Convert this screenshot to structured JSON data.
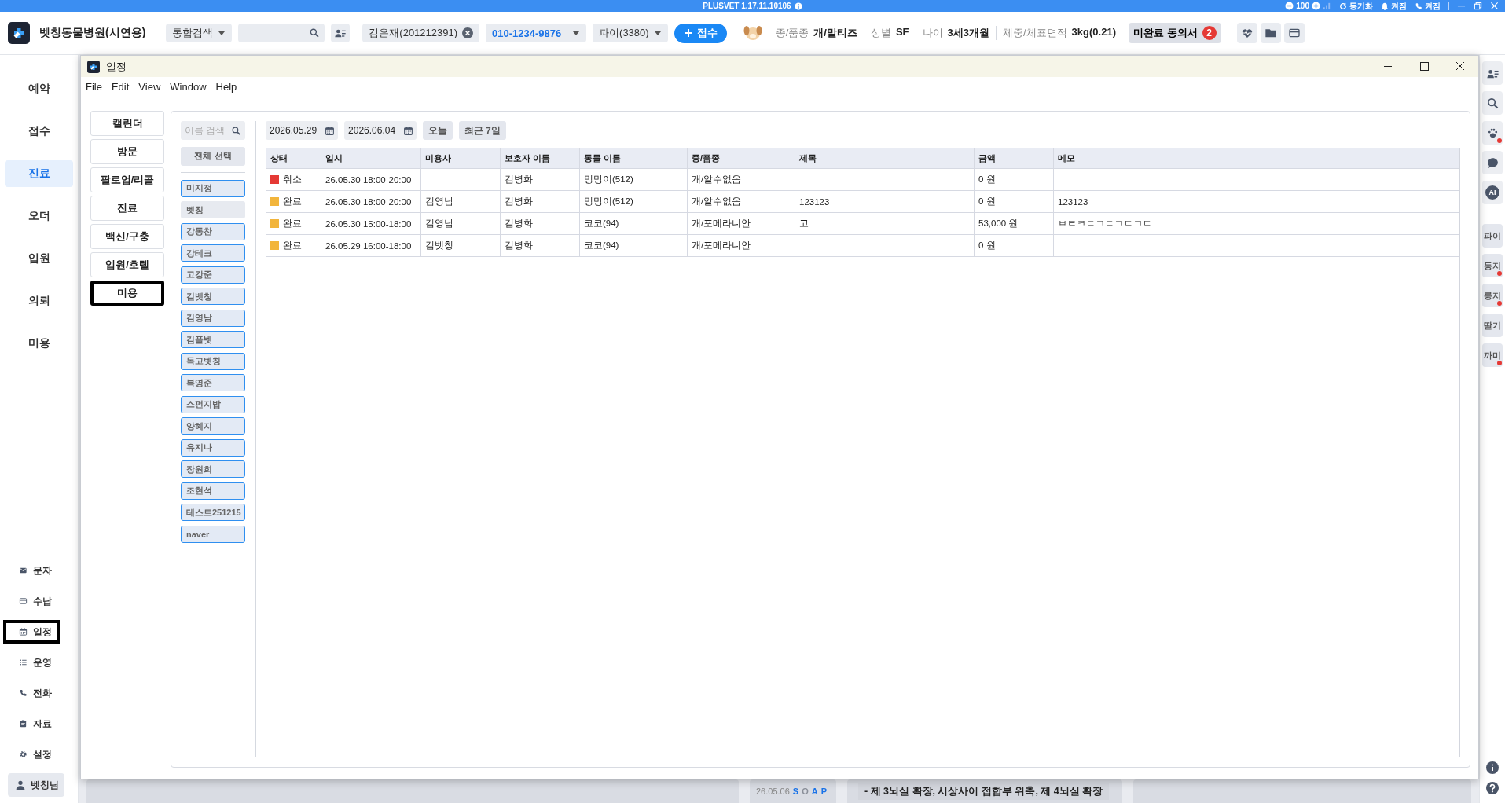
{
  "app_bar": {
    "product": "PLUSVET",
    "version": "1.17.11.10106",
    "zoom": "100",
    "sync": "동기화",
    "notifications": "켜짐",
    "phone": "켜짐"
  },
  "header": {
    "clinic": "벳칭동물병원(시연용)",
    "search_type": "통합검색",
    "patient": "김은재(201212391)",
    "phone": "010-1234-9876",
    "pet": "파이(3380)",
    "register_button": "접수",
    "info": [
      {
        "label": "종/품종",
        "value": "개/말티즈"
      },
      {
        "label": "성별",
        "value": "SF"
      },
      {
        "label": "나이",
        "value": "3세3개월"
      },
      {
        "label": "체중/체표면적",
        "value": "3kg(0.21)"
      }
    ],
    "consent": {
      "label": "미완료 동의서",
      "count": "2"
    }
  },
  "sidebar": {
    "items": [
      {
        "label": "예약",
        "selected": false
      },
      {
        "label": "접수",
        "selected": false
      },
      {
        "label": "진료",
        "selected": true
      },
      {
        "label": "오더",
        "selected": false
      },
      {
        "label": "입원",
        "selected": false
      },
      {
        "label": "의뢰",
        "selected": false
      },
      {
        "label": "미용",
        "selected": false
      }
    ],
    "tools": [
      {
        "kind": "mail",
        "label": "문자",
        "selected": false
      },
      {
        "kind": "card",
        "label": "수납",
        "selected": false
      },
      {
        "kind": "calendar",
        "label": "일정",
        "selected": true
      },
      {
        "kind": "list",
        "label": "운영",
        "selected": false
      },
      {
        "kind": "phone",
        "label": "전화",
        "selected": false
      },
      {
        "kind": "clipboard",
        "label": "자료",
        "selected": false
      },
      {
        "kind": "gear",
        "label": "설정",
        "selected": false
      }
    ],
    "user": "벳칭님"
  },
  "window": {
    "title": "일정",
    "menu": [
      "File",
      "Edit",
      "View",
      "Window",
      "Help"
    ],
    "categories": [
      {
        "label": "캘린더",
        "selected": false
      },
      {
        "label": "방문",
        "selected": false
      },
      {
        "label": "팔로업/리콜",
        "selected": false
      },
      {
        "label": "진료",
        "selected": false
      },
      {
        "label": "백신/구충",
        "selected": false
      },
      {
        "label": "입원/호텔",
        "selected": false
      },
      {
        "label": "미용",
        "selected": true
      }
    ],
    "name_search": {
      "placeholder": "이름 검색"
    },
    "select_all": "전체 선택",
    "groomers": [
      {
        "name": "미지정",
        "selected": true
      },
      {
        "name": "벳칭",
        "selected": false
      },
      {
        "name": "강동찬",
        "selected": true
      },
      {
        "name": "강테크",
        "selected": true
      },
      {
        "name": "고강준",
        "selected": true
      },
      {
        "name": "김벳칭",
        "selected": true
      },
      {
        "name": "김영남",
        "selected": true
      },
      {
        "name": "김플벳",
        "selected": true
      },
      {
        "name": "독고벳칭",
        "selected": true
      },
      {
        "name": "복영준",
        "selected": true
      },
      {
        "name": "스펀지밥",
        "selected": true
      },
      {
        "name": "양혜지",
        "selected": true
      },
      {
        "name": "유지나",
        "selected": true
      },
      {
        "name": "장원희",
        "selected": true
      },
      {
        "name": "조현석",
        "selected": true
      },
      {
        "name": "테스트251215",
        "selected": true
      },
      {
        "name": "naver",
        "selected": true
      }
    ],
    "date_from": "2026.05.29",
    "date_to": "2026.06.04",
    "today": "오늘",
    "last7": "최근 7일",
    "table": {
      "columns": [
        "상태",
        "일시",
        "미용사",
        "보호자 이름",
        "동물 이름",
        "종/품종",
        "제목",
        "금액",
        "메모"
      ],
      "rows": [
        {
          "status": "취소",
          "color": "#e53935",
          "datetime": "26.05.30 18:00-20:00",
          "guardian": "김병화",
          "pet": "멍망이(512)",
          "breed": "개/알수없음",
          "amount": "0 원"
        },
        {
          "status": "완료",
          "color": "#f2b53c",
          "datetime": "26.05.30 18:00-20:00",
          "groomer": "김영남",
          "guardian": "김병화",
          "pet": "멍망이(512)",
          "breed": "개/알수없음",
          "title": "123123",
          "amount": "0 원",
          "memo": "123123"
        },
        {
          "status": "완료",
          "color": "#f2b53c",
          "datetime": "26.05.30 15:00-18:00",
          "groomer": "김영남",
          "guardian": "김병화",
          "pet": "코코(94)",
          "breed": "개/포메라니안",
          "title": "고",
          "amount": "53,000 원",
          "memo": "ㅂㅌㅋㄷㄱㄷㄱㄷㄱㄷ"
        },
        {
          "status": "완료",
          "color": "#f2b53c",
          "datetime": "26.05.29 16:00-18:00",
          "groomer": "김벳칭",
          "guardian": "김병화",
          "pet": "코코(94)",
          "breed": "개/포메라니안",
          "amount": "0 원"
        }
      ]
    }
  },
  "right_bar": {
    "tools": [
      {
        "kind": "contacts",
        "alert": false
      },
      {
        "kind": "search",
        "alert": false
      },
      {
        "kind": "paw",
        "alert": true
      },
      {
        "kind": "chat",
        "alert": false
      },
      {
        "kind": "ai",
        "label": "AI",
        "alert": false
      }
    ],
    "pets": [
      {
        "name": "파이",
        "alert": false
      },
      {
        "name": "동지",
        "alert": true
      },
      {
        "name": "룽지",
        "alert": true
      },
      {
        "name": "딸기",
        "alert": false
      },
      {
        "name": "까미",
        "alert": true
      }
    ]
  },
  "background": {
    "record_date": "26.05.06",
    "soap": [
      {
        "letter": "S",
        "active": true
      },
      {
        "letter": "O",
        "active": false
      },
      {
        "letter": "A",
        "active": true
      },
      {
        "letter": "P",
        "active": true
      }
    ],
    "note": "- 제 3뇌실 확장, 시상사이 접합부 위축, 제 4뇌실 확장"
  }
}
